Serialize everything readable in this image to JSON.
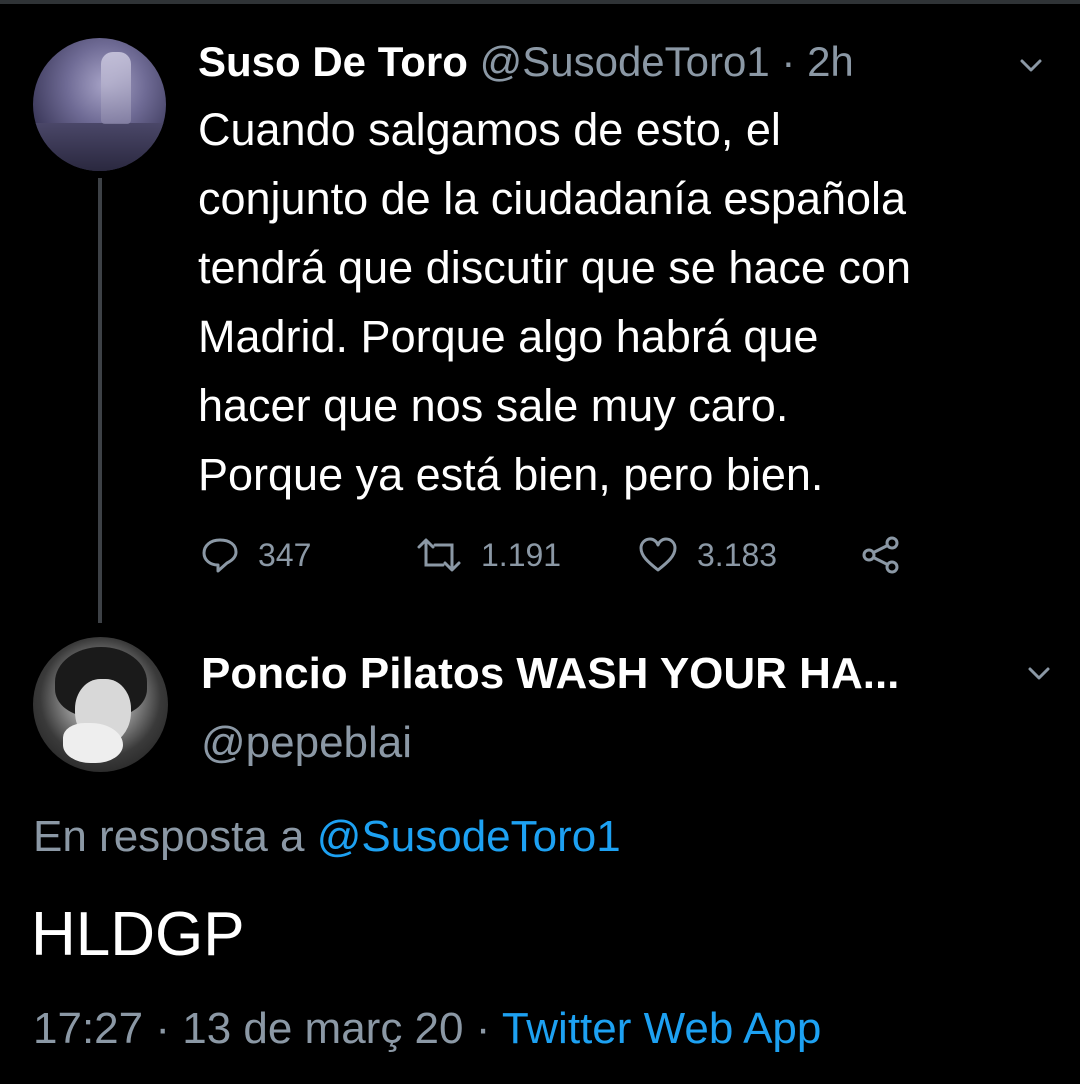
{
  "parent_tweet": {
    "display_name": "Suso De Toro",
    "handle": "@SusodeToro1",
    "separator": "·",
    "time_ago": "2h",
    "text_lines": [
      "Cuando salgamos de esto, el",
      "conjunto de la ciudadanía española",
      "tendrá que discutir que se hace con",
      "Madrid. Porque algo habrá que",
      "hacer que nos sale muy caro.",
      "Porque ya está bien, pero bien."
    ],
    "replies": "347",
    "retweets": "1.191",
    "likes": "3.183",
    "icons": {
      "reply": "reply-icon",
      "retweet": "retweet-icon",
      "like": "heart-icon",
      "share": "share-icon",
      "menu": "chevron-down-icon"
    }
  },
  "reply_tweet": {
    "display_name": "Poncio Pilatos WASH YOUR HA...",
    "handle": "@pepeblai",
    "in_reply_to_label": "En resposta a ",
    "in_reply_to_handle": "@SusodeToro1",
    "text": "HLDGP",
    "time": "17:27",
    "separator1": " · ",
    "date": "13 de març 20",
    "separator2": " · ",
    "source": "Twitter Web App"
  },
  "colors": {
    "background": "#000000",
    "text": "#ffffff",
    "muted": "#8b98a5",
    "link": "#1da1f2",
    "thread_line": "#3d4146"
  }
}
